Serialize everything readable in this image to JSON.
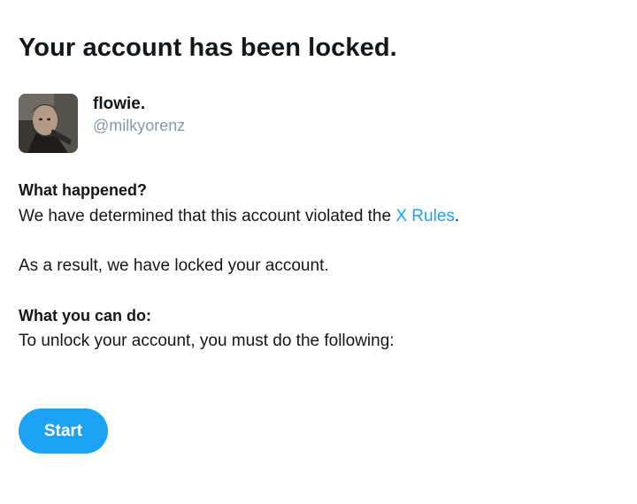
{
  "page": {
    "title": "Your account has been locked."
  },
  "user": {
    "display_name": "flowie.",
    "handle": "@milkyorenz"
  },
  "what_happened": {
    "heading": "What happened?",
    "text_before_link": "We have determined that this account violated the ",
    "link_label": "X Rules",
    "text_after_link": "."
  },
  "result": {
    "text": "As a result, we have locked your account."
  },
  "what_you_can_do": {
    "heading": "What you can do:",
    "text": "To unlock your account, you must do the following:"
  },
  "actions": {
    "start_label": "Start"
  },
  "colors": {
    "accent": "#1da1f2",
    "text_primary": "#14171a",
    "text_secondary": "#8899a6"
  }
}
